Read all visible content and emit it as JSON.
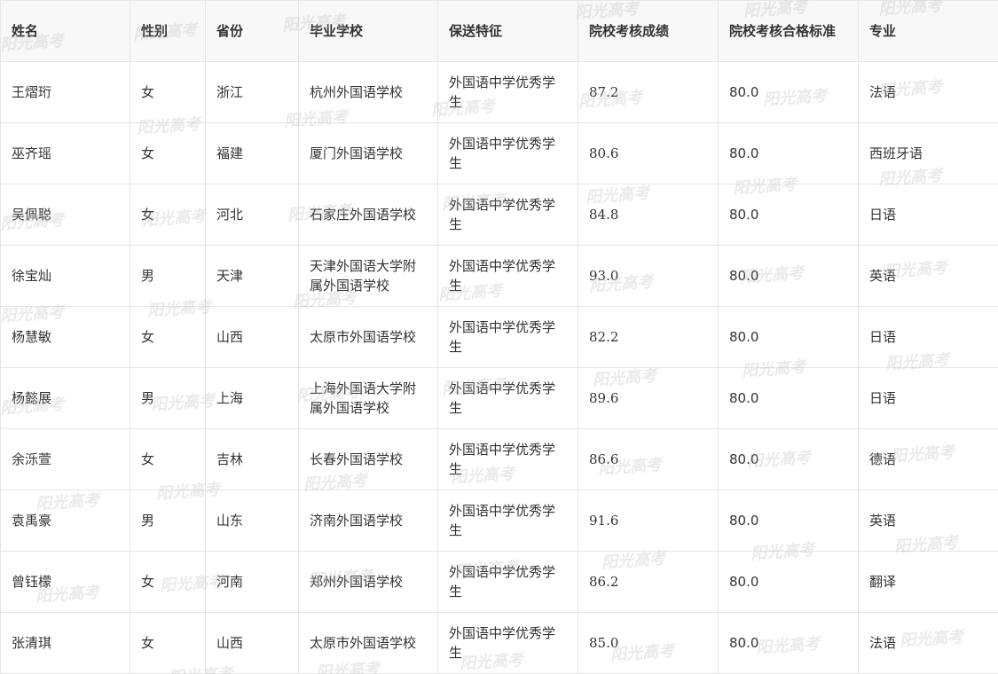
{
  "table": {
    "headers": [
      "姓名",
      "性别",
      "省份",
      "毕业学校",
      "保送特征",
      "院校考核成绩",
      "院校考核合格标准",
      "专业"
    ],
    "rows": [
      [
        "王熠珩",
        "女",
        "浙江",
        "杭州外国语学校",
        "外国语中学优秀学生",
        "87.2",
        "80.0",
        "法语"
      ],
      [
        "巫齐瑶",
        "女",
        "福建",
        "厦门外国语学校",
        "外国语中学优秀学生",
        "80.6",
        "80.0",
        "西班牙语"
      ],
      [
        "吴佩聪",
        "女",
        "河北",
        "石家庄外国语学校",
        "外国语中学优秀学生",
        "84.8",
        "80.0",
        "日语"
      ],
      [
        "徐宝灿",
        "男",
        "天津",
        "天津外国语大学附属外国语学校",
        "外国语中学优秀学生",
        "93.0",
        "80.0",
        "英语"
      ],
      [
        "杨慧敏",
        "女",
        "山西",
        "太原市外国语学校",
        "外国语中学优秀学生",
        "82.2",
        "80.0",
        "日语"
      ],
      [
        "杨懿展",
        "男",
        "上海",
        "上海外国语大学附属外国语学校",
        "外国语中学优秀学生",
        "89.6",
        "80.0",
        "日语"
      ],
      [
        "余泺萱",
        "女",
        "吉林",
        "长春外国语学校",
        "外国语中学优秀学生",
        "86.6",
        "80.0",
        "德语"
      ],
      [
        "袁禹豪",
        "男",
        "山东",
        "济南外国语学校",
        "外国语中学优秀学生",
        "91.6",
        "80.0",
        "英语"
      ],
      [
        "曾钰檬",
        "女",
        "河南",
        "郑州外国语学校",
        "外国语中学优秀学生",
        "86.2",
        "80.0",
        "翻译"
      ],
      [
        "张清琪",
        "女",
        "山西",
        "太原市外国语学校",
        "外国语中学优秀学生",
        "85.0",
        "80.0",
        "法语"
      ]
    ]
  },
  "watermark": {
    "text": "阳光高考",
    "color": "#b4b4b4"
  }
}
